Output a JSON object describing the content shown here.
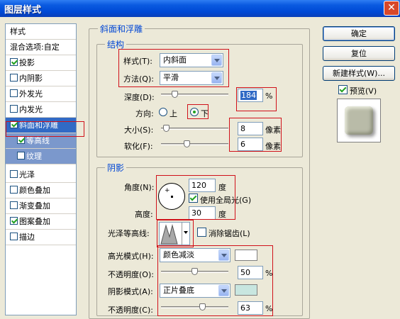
{
  "window": {
    "title": "图层样式"
  },
  "left_panel": {
    "header": "样式",
    "blend_options": "混合选项:自定",
    "items": [
      {
        "label": "投影",
        "checked": true
      },
      {
        "label": "内阴影",
        "checked": false
      },
      {
        "label": "外发光",
        "checked": false
      },
      {
        "label": "内发光",
        "checked": false
      },
      {
        "label": "斜面和浮雕",
        "checked": true
      },
      {
        "label": "等高线",
        "checked": true
      },
      {
        "label": "纹理",
        "checked": false
      },
      {
        "label": "光泽",
        "checked": false
      },
      {
        "label": "颜色叠加",
        "checked": false
      },
      {
        "label": "渐变叠加",
        "checked": false
      },
      {
        "label": "图案叠加",
        "checked": true
      },
      {
        "label": "描边",
        "checked": false
      }
    ]
  },
  "bevel": {
    "title": "斜面和浮雕",
    "structure": {
      "title": "结构",
      "style_label": "样式(T):",
      "style_value": "内斜面",
      "method_label": "方法(Q):",
      "method_value": "平滑",
      "depth_label": "深度(D):",
      "depth_value": "184",
      "depth_unit": "%",
      "depth_percent": 0.18,
      "direction_label": "方向:",
      "dir_up": "上",
      "dir_down": "下",
      "size_label": "大小(S):",
      "size_value": "8",
      "size_unit": "像素",
      "size_fraction": 0.03,
      "soften_label": "软化(F):",
      "soften_value": "6",
      "soften_unit": "像素",
      "soften_fraction": 0.37
    },
    "shading": {
      "title": "阴影",
      "angle_label": "角度(N):",
      "angle_value": "120",
      "angle_unit": "度",
      "global_light": "使用全局光(G)",
      "altitude_label": "高度:",
      "altitude_value": "30",
      "altitude_unit": "度",
      "gloss_label": "光泽等高线:",
      "antialias": "消除锯齿(L)",
      "highlight_label": "高光模式(H):",
      "highlight_value": "颜色减淡",
      "highlight_color": "#ffffff",
      "opacity1_label": "不透明度(O):",
      "opacity1_value": "50",
      "opacity1_unit": "%",
      "opacity1_fraction": 0.5,
      "shadow_label": "阴影模式(A):",
      "shadow_value": "正片叠底",
      "shadow_color": "#c8e6e0",
      "opacity2_label": "不透明度(C):",
      "opacity2_value": "63",
      "opacity2_unit": "%",
      "opacity2_fraction": 0.63
    }
  },
  "buttons": {
    "ok": "确定",
    "reset": "复位",
    "new_style": "新建样式(W)...",
    "preview": "预览(V)"
  }
}
